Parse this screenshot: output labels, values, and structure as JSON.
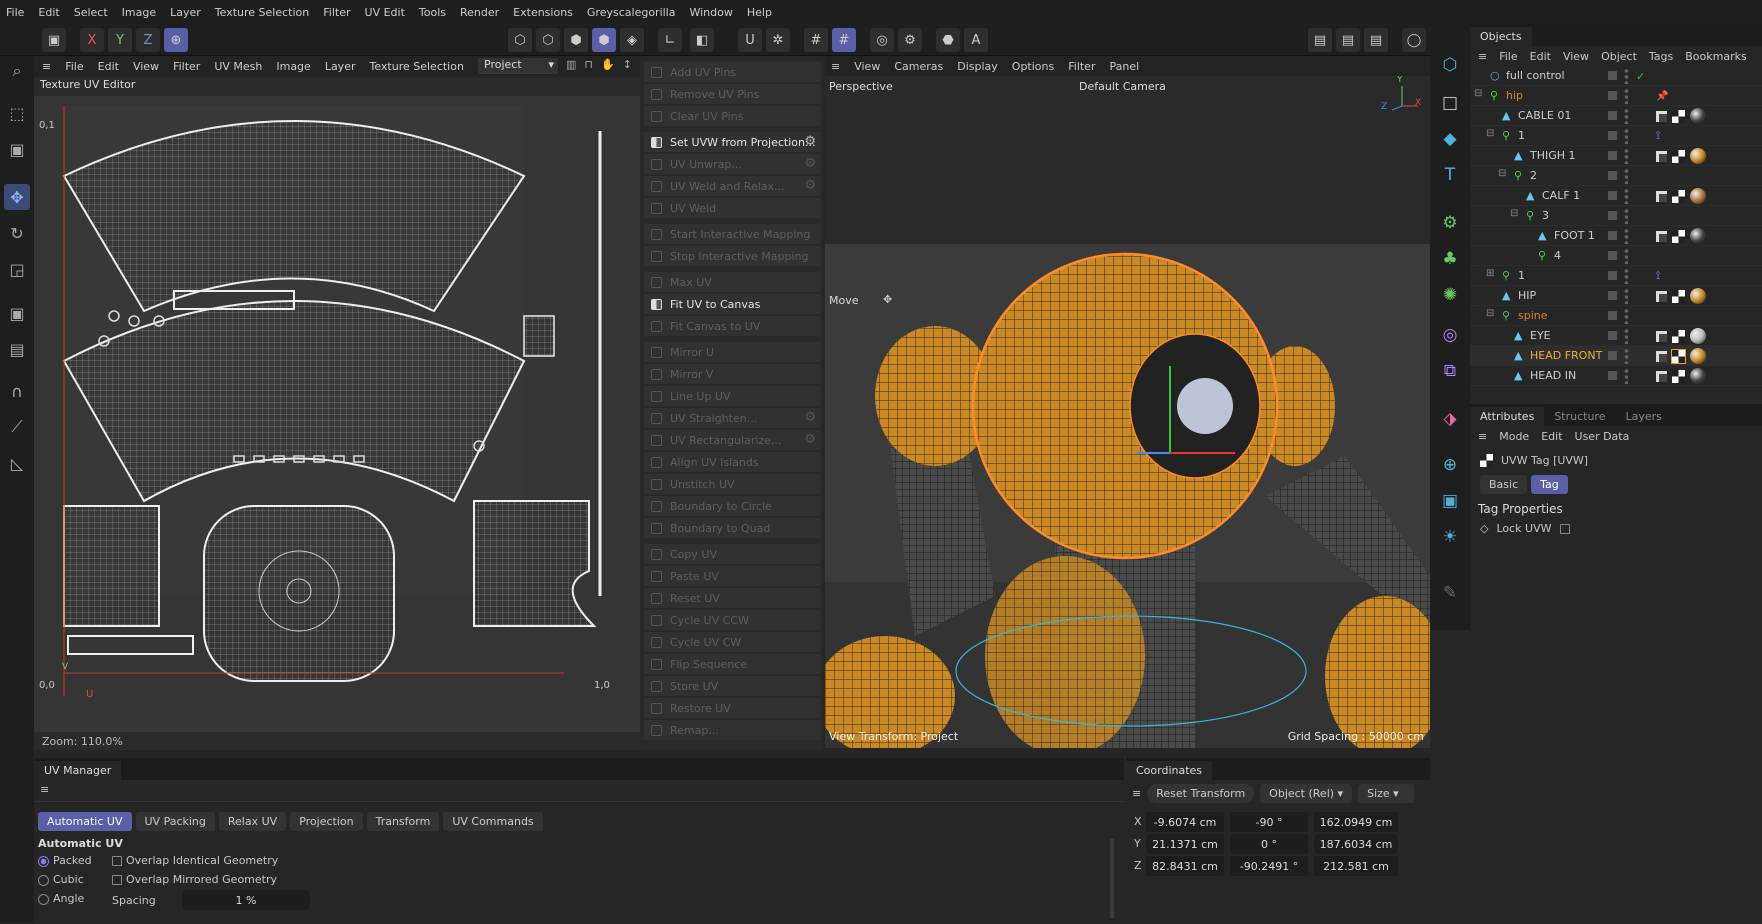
{
  "menubar": [
    "File",
    "Edit",
    "Select",
    "Image",
    "Layer",
    "Texture Selection",
    "Filter",
    "UV Edit",
    "Tools",
    "Render",
    "Extensions",
    "Greyscalegorilla",
    "Window",
    "Help"
  ],
  "toolbar": {
    "axis_x": "X",
    "axis_y": "Y",
    "axis_z": "Z"
  },
  "uv_editor": {
    "menu": [
      "File",
      "Edit",
      "View",
      "Filter",
      "UV Mesh",
      "Image",
      "Layer",
      "Texture Selection",
      ">"
    ],
    "project_select": "Project",
    "title": "Texture UV Editor",
    "label_v1": "0,1",
    "label_00": "0,0",
    "label_u1": "1,0",
    "label_u": "U",
    "label_v": "V",
    "zoom": "Zoom: 110.0%"
  },
  "uv_commands": [
    {
      "label": "Add UV Pins",
      "active": false,
      "gear": false,
      "group": 0
    },
    {
      "label": "Remove UV Pins",
      "active": false,
      "gear": false,
      "group": 0
    },
    {
      "label": "Clear UV Pins",
      "active": false,
      "gear": false,
      "group": 0
    },
    {
      "label": "Set UVW from Projection...",
      "active": true,
      "gear": true,
      "group": 1
    },
    {
      "label": "UV Unwrap...",
      "active": false,
      "gear": true,
      "group": 1
    },
    {
      "label": "UV Weld and Relax...",
      "active": false,
      "gear": true,
      "group": 1
    },
    {
      "label": "UV Weld",
      "active": false,
      "gear": false,
      "group": 1
    },
    {
      "label": "Start Interactive Mapping",
      "active": false,
      "gear": false,
      "group": 2
    },
    {
      "label": "Stop Interactive Mapping",
      "active": false,
      "gear": false,
      "group": 2
    },
    {
      "label": "Max UV",
      "active": false,
      "gear": false,
      "group": 3
    },
    {
      "label": "Fit UV to Canvas",
      "active": true,
      "gear": false,
      "group": 3
    },
    {
      "label": "Fit Canvas to UV",
      "active": false,
      "gear": false,
      "group": 3
    },
    {
      "label": "Mirror U",
      "active": false,
      "gear": false,
      "group": 4
    },
    {
      "label": "Mirror V",
      "active": false,
      "gear": false,
      "group": 4
    },
    {
      "label": "Line Up UV",
      "active": false,
      "gear": false,
      "group": 4
    },
    {
      "label": "UV Straighten...",
      "active": false,
      "gear": true,
      "group": 4
    },
    {
      "label": "UV Rectangularize...",
      "active": false,
      "gear": true,
      "group": 4
    },
    {
      "label": "Align UV Islands",
      "active": false,
      "gear": false,
      "group": 4
    },
    {
      "label": "Unstitch UV",
      "active": false,
      "gear": false,
      "group": 4
    },
    {
      "label": "Boundary to Circle",
      "active": false,
      "gear": false,
      "group": 4
    },
    {
      "label": "Boundary to Quad",
      "active": false,
      "gear": false,
      "group": 4
    },
    {
      "label": "Copy UV",
      "active": false,
      "gear": false,
      "group": 5
    },
    {
      "label": "Paste UV",
      "active": false,
      "gear": false,
      "group": 5
    },
    {
      "label": "Reset UV",
      "active": false,
      "gear": false,
      "group": 5
    },
    {
      "label": "Cycle UV CCW",
      "active": false,
      "gear": false,
      "group": 5
    },
    {
      "label": "Cycle UV CW",
      "active": false,
      "gear": false,
      "group": 5
    },
    {
      "label": "Flip Sequence",
      "active": false,
      "gear": false,
      "group": 5
    },
    {
      "label": "Store UV",
      "active": false,
      "gear": false,
      "group": 5
    },
    {
      "label": "Restore UV",
      "active": false,
      "gear": false,
      "group": 5
    },
    {
      "label": "Remap...",
      "active": false,
      "gear": false,
      "group": 5
    }
  ],
  "viewport": {
    "menu": [
      "View",
      "Cameras",
      "Display",
      "Options",
      "Filter",
      "Panel"
    ],
    "name": "Perspective",
    "camera": "Default Camera",
    "tool": "Move",
    "view_transform": "View Transform: Project",
    "grid_spacing": "Grid Spacing : 50000 cm",
    "axis_y": "Y",
    "axis_x": "X",
    "axis_z": "Z"
  },
  "objects": {
    "tab": "Objects",
    "menu": [
      "File",
      "Edit",
      "View",
      "Object",
      "Tags",
      "Bookmarks"
    ],
    "rows": [
      {
        "name": "full control",
        "indent": 0,
        "type": "null",
        "color": "#cfcfcf",
        "tags": "check"
      },
      {
        "name": "hip",
        "indent": 0,
        "type": "joint",
        "color": "#d9823a",
        "tags": "pin",
        "expand": "-"
      },
      {
        "name": "CABLE 01",
        "indent": 1,
        "type": "mesh",
        "color": "#cfcfcf",
        "tags": "mat",
        "mat": "#444"
      },
      {
        "name": "1",
        "indent": 1,
        "type": "joint",
        "color": "#cfcfcf",
        "tags": "ik",
        "expand": "-"
      },
      {
        "name": "THIGH 1",
        "indent": 2,
        "type": "mesh",
        "color": "#cfcfcf",
        "tags": "mat",
        "mat": "#c98a25"
      },
      {
        "name": "2",
        "indent": 2,
        "type": "joint",
        "color": "#cfcfcf",
        "tags": "",
        "expand": "-"
      },
      {
        "name": "CALF 1",
        "indent": 3,
        "type": "mesh",
        "color": "#cfcfcf",
        "tags": "mat",
        "mat": "#a8783a"
      },
      {
        "name": "3",
        "indent": 3,
        "type": "joint",
        "color": "#cfcfcf",
        "tags": "",
        "expand": "-"
      },
      {
        "name": "FOOT 1",
        "indent": 4,
        "type": "mesh",
        "color": "#cfcfcf",
        "tags": "mat",
        "mat": "#444"
      },
      {
        "name": "4",
        "indent": 4,
        "type": "joint",
        "color": "#cfcfcf",
        "tags": ""
      },
      {
        "name": "1",
        "indent": 1,
        "type": "joint",
        "color": "#cfcfcf",
        "tags": "ik",
        "expand": "+"
      },
      {
        "name": "HIP",
        "indent": 1,
        "type": "mesh",
        "color": "#cfcfcf",
        "tags": "mat",
        "mat": "#c98a25"
      },
      {
        "name": "spine",
        "indent": 1,
        "type": "joint",
        "color": "#d9823a",
        "tags": "",
        "expand": "-"
      },
      {
        "name": "EYE",
        "indent": 2,
        "type": "mesh",
        "color": "#cfcfcf",
        "tags": "mat",
        "mat": "#bbb"
      },
      {
        "name": "HEAD FRONT",
        "indent": 2,
        "type": "mesh",
        "color": "#f0b040",
        "tags": "mat",
        "mat": "#c98a25"
      },
      {
        "name": "HEAD IN",
        "indent": 2,
        "type": "mesh",
        "color": "#cfcfcf",
        "tags": "mat",
        "mat": "#444"
      }
    ]
  },
  "attributes": {
    "tabs": [
      "Attributes",
      "Structure",
      "Layers"
    ],
    "menu": [
      "Mode",
      "Edit",
      "User Data"
    ],
    "tag_title": "UVW Tag [UVW]",
    "buttons": [
      "Basic",
      "Tag"
    ],
    "section": "Tag Properties",
    "lock_label": "Lock UVW"
  },
  "uv_manager": {
    "title": "UV Manager",
    "tabs": [
      "Automatic UV",
      "UV Packing",
      "Relax UV",
      "Projection",
      "Transform",
      "UV Commands"
    ],
    "section": "Automatic UV",
    "modes": [
      "Packed",
      "Cubic",
      "Angle"
    ],
    "overlap_identical": "Overlap Identical Geometry",
    "overlap_mirrored": "Overlap Mirrored Geometry",
    "spacing_label": "Spacing",
    "spacing_value": "1 %"
  },
  "coordinates": {
    "title": "Coordinates",
    "reset": "Reset Transform",
    "mode": "Object (Rel)",
    "size_mode": "Size",
    "rows": [
      {
        "axis": "X",
        "pos": "-9.6074 cm",
        "rot": "-90 °",
        "size": "162.0949 cm"
      },
      {
        "axis": "Y",
        "pos": "21.1371 cm",
        "rot": "0 °",
        "size": "187.6034 cm"
      },
      {
        "axis": "Z",
        "pos": "82.8431 cm",
        "rot": "-90.2491 °",
        "size": "212.581 cm"
      }
    ]
  },
  "colors": {
    "accent": "#5a5fa8",
    "orange": "#d9823a",
    "selection": "#ff8a2a"
  }
}
